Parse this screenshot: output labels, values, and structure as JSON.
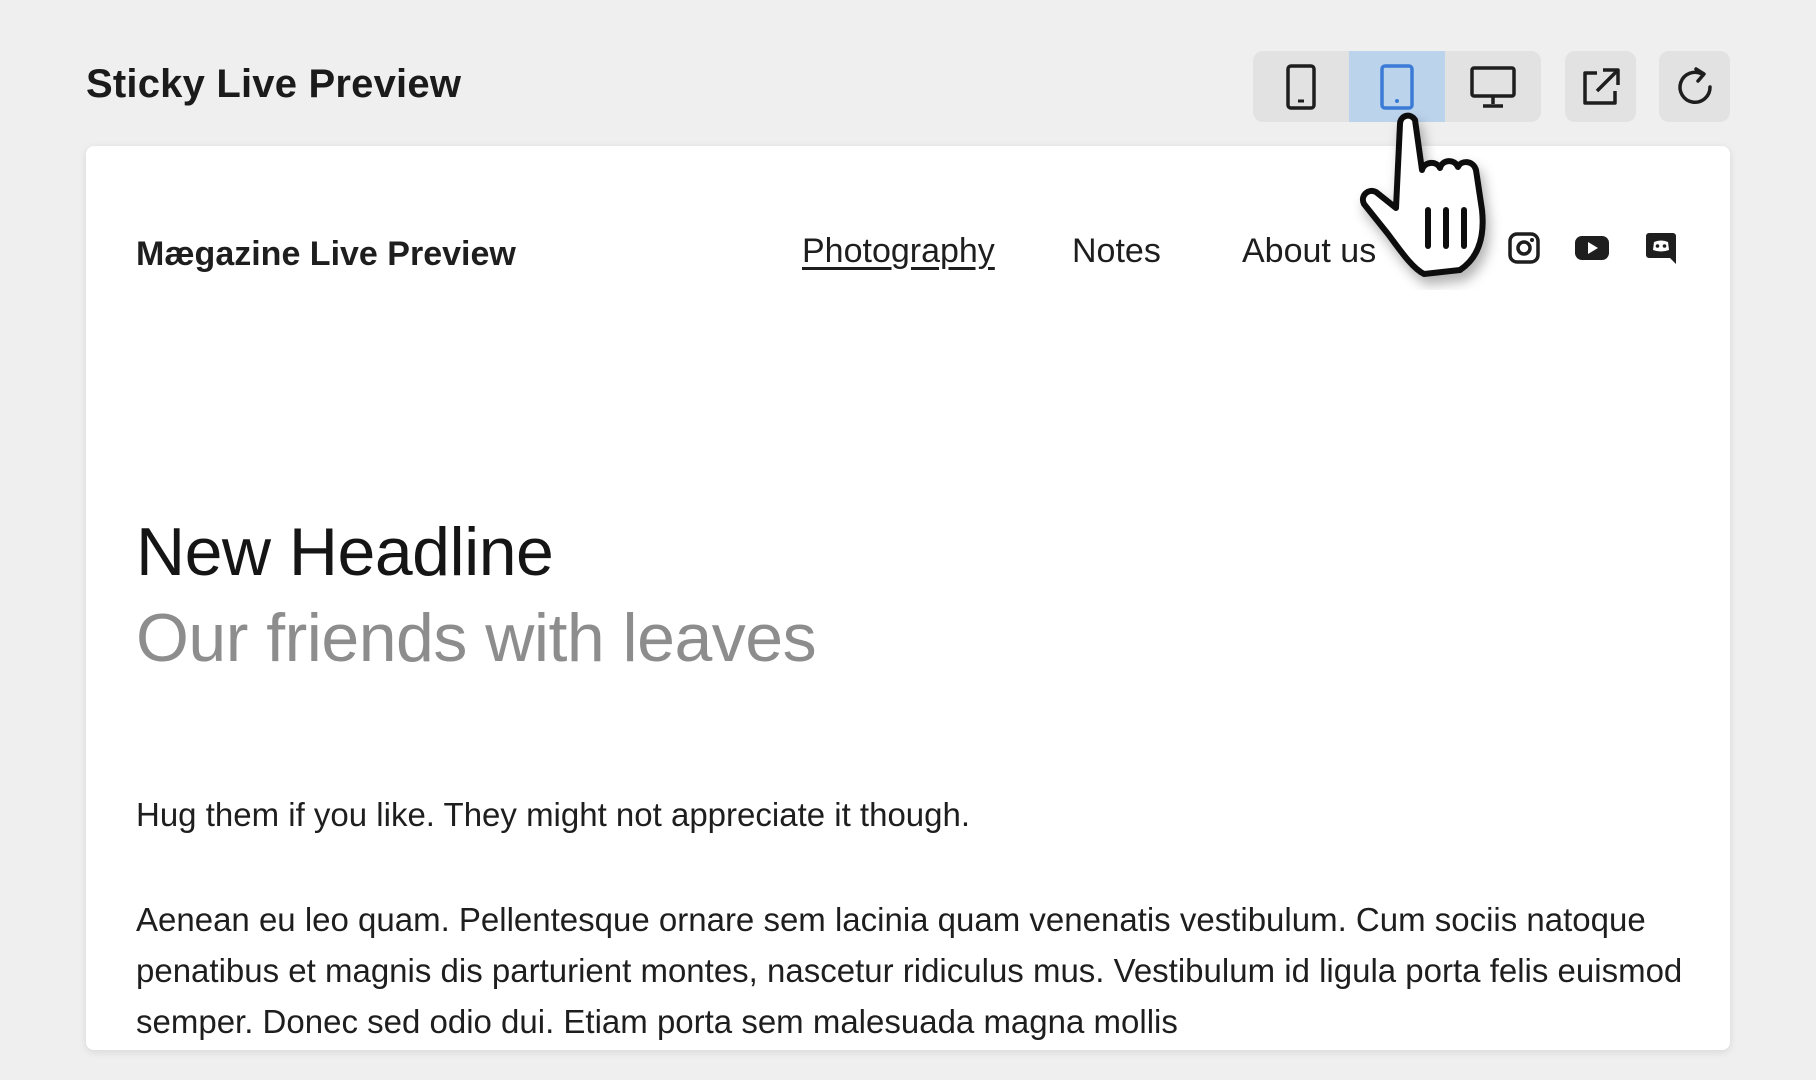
{
  "app": {
    "title": "Sticky Live Preview"
  },
  "toolbar": {
    "devices": [
      {
        "name": "phone-view-button",
        "icon": "phone-icon",
        "active": false
      },
      {
        "name": "tablet-view-button",
        "icon": "tablet-icon",
        "active": true
      },
      {
        "name": "desktop-view-button",
        "icon": "desktop-icon",
        "active": false
      }
    ],
    "open_external_icon": "external-link-icon",
    "refresh_icon": "refresh-icon",
    "active_color": "#bcd3ec",
    "active_icon_color": "#3a7bd5"
  },
  "site": {
    "title": "Mægazine Live Preview",
    "nav": [
      {
        "label": "Photography",
        "current": true
      },
      {
        "label": "Notes",
        "current": false
      },
      {
        "label": "About us",
        "current": false
      }
    ],
    "social": [
      "instagram-icon",
      "youtube-icon",
      "discord-icon"
    ]
  },
  "content": {
    "headline": "New Headline",
    "subheadline": "Our friends with leaves",
    "lead": "Hug them if you like. They might not appreciate it though.",
    "body": "Aenean eu leo quam. Pellentesque ornare sem lacinia quam venenatis vestibulum. Cum sociis natoque penatibus et magnis dis parturient montes, nascetur ridiculus mus. Vestibulum id ligula porta felis euismod semper. Donec sed odio dui. Etiam porta sem malesuada magna mollis"
  }
}
